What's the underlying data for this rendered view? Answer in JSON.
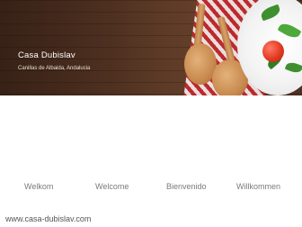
{
  "hero": {
    "title": "Casa Dubislav",
    "subtitle": "Canillas de Albaida, Andalucia"
  },
  "languages": [
    {
      "label": "Welkom"
    },
    {
      "label": "Welcome"
    },
    {
      "label": "Bienvenido"
    },
    {
      "label": "Willkommen"
    }
  ],
  "footer": {
    "text": "www.casa-dubislav.com"
  }
}
